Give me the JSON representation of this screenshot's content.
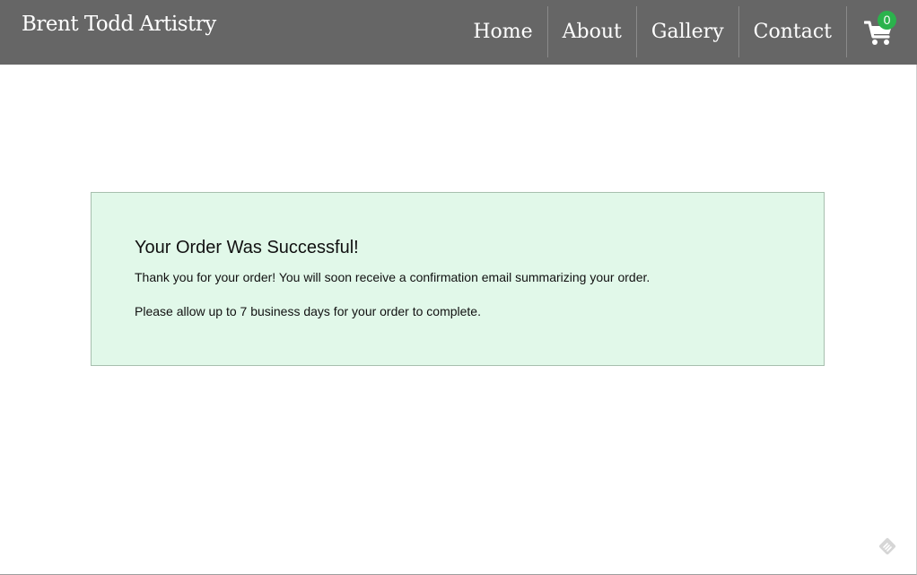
{
  "header": {
    "brand": "Brent Todd Artistry",
    "nav": [
      {
        "label": "Home"
      },
      {
        "label": "About"
      },
      {
        "label": "Gallery"
      },
      {
        "label": "Contact"
      }
    ],
    "cart": {
      "icon": "shopping-cart-icon",
      "count": "0"
    }
  },
  "main": {
    "title": "Your Order Was Successful!",
    "message_1": "Thank you for your order! You will soon receive a confirmation email summarizing your order.",
    "message_2": "Please allow up to 7 business days for your order to complete."
  },
  "colors": {
    "header_bg": "#666666",
    "badge": "#2bb24c",
    "success_bg": "#e1f8e9",
    "success_border": "#a7bfae"
  },
  "corner": {
    "icon": "feedback-badge-icon"
  }
}
